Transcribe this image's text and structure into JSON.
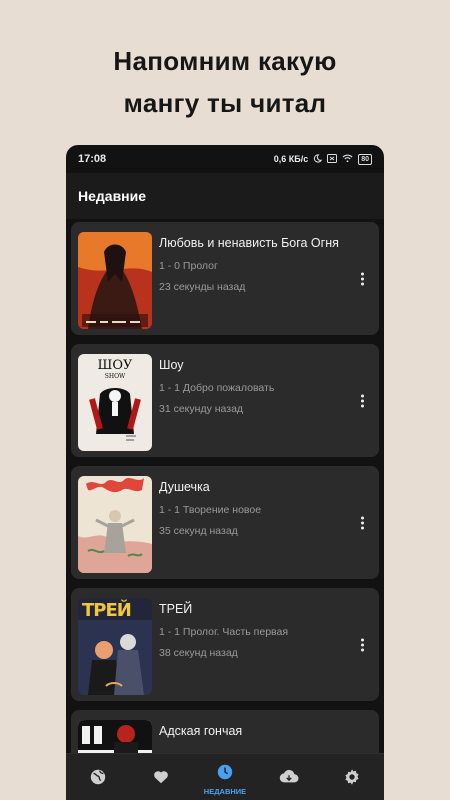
{
  "headline": {
    "line1": "Напомним какую",
    "line2": "мангу ты читал"
  },
  "statusbar": {
    "time": "17:08",
    "speed": "0,6 КБ/с",
    "battery": "80"
  },
  "appbar": {
    "title": "Недавние"
  },
  "items": [
    {
      "title": "Любовь и ненависть Бога Огня",
      "chapter": "1 - 0 Пролог",
      "ago": "23 секунды назад"
    },
    {
      "title": "Шоу",
      "chapter": "1 - 1 Добро пожаловать",
      "ago": "31 секунду назад",
      "cover_text": "ШОУ",
      "cover_subtext": "SHOW"
    },
    {
      "title": "Душечка",
      "chapter": "1 - 1 Творение новое",
      "ago": "35 секунд назад"
    },
    {
      "title": "ТРЕЙ",
      "chapter": "1 - 1 Пролог. Часть первая",
      "ago": "38 секунд назад",
      "cover_text": "ТРЕЙ"
    },
    {
      "title": "Адская гончая",
      "chapter": "",
      "ago": ""
    }
  ],
  "bottomnav": {
    "items": [
      {
        "icon": "globe-icon",
        "label": ""
      },
      {
        "icon": "heart-icon",
        "label": ""
      },
      {
        "icon": "clock-icon",
        "label": "НЕДАВНИЕ",
        "active": true
      },
      {
        "icon": "download-icon",
        "label": ""
      },
      {
        "icon": "gear-icon",
        "label": ""
      }
    ]
  },
  "colors": {
    "background": "#e8ddd2",
    "phone_bg": "#121212",
    "card_bg": "#2b2b2b",
    "accent": "#4aa0f0"
  }
}
